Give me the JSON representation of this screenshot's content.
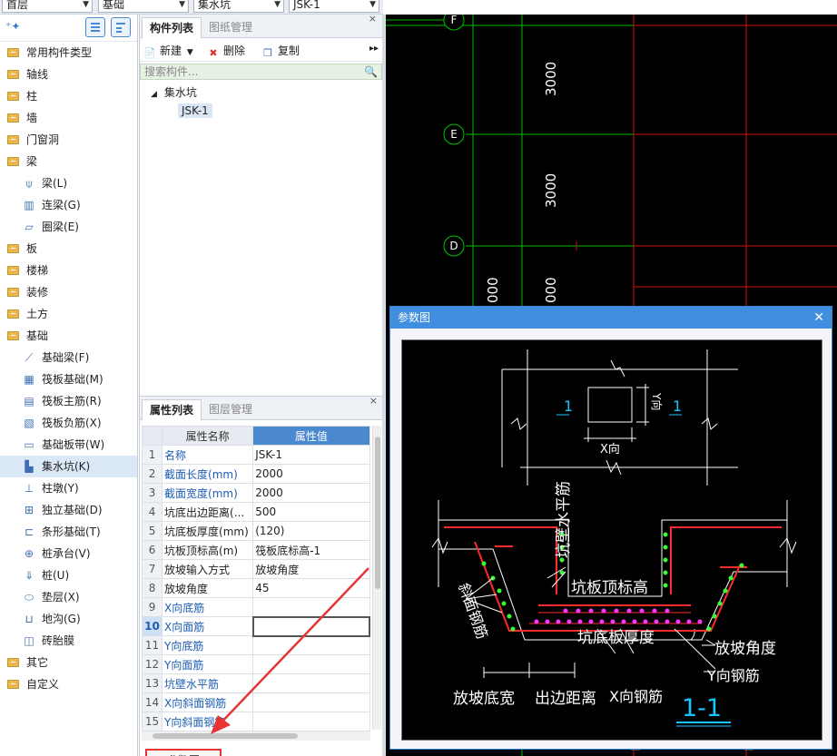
{
  "toolbar": {
    "floor": "首层",
    "category": "基础",
    "component_type": "集水坑",
    "component": "JSK-1"
  },
  "tree": {
    "items": [
      {
        "label": "常用构件类型",
        "level": 0,
        "icon": "folder-icon"
      },
      {
        "label": "轴线",
        "level": 0,
        "icon": "folder-icon"
      },
      {
        "label": "柱",
        "level": 0,
        "icon": "folder-icon"
      },
      {
        "label": "墙",
        "level": 0,
        "icon": "folder-icon"
      },
      {
        "label": "门窗洞",
        "level": 0,
        "icon": "folder-icon"
      },
      {
        "label": "梁",
        "level": 0,
        "icon": "folder-icon"
      },
      {
        "label": "梁(L)",
        "level": 1,
        "icon": "beam-icon"
      },
      {
        "label": "连梁(G)",
        "level": 1,
        "icon": "link-beam-icon"
      },
      {
        "label": "圈梁(E)",
        "level": 1,
        "icon": "ring-beam-icon"
      },
      {
        "label": "板",
        "level": 0,
        "icon": "folder-icon"
      },
      {
        "label": "楼梯",
        "level": 0,
        "icon": "folder-icon"
      },
      {
        "label": "装修",
        "level": 0,
        "icon": "folder-icon"
      },
      {
        "label": "土方",
        "level": 0,
        "icon": "folder-icon"
      },
      {
        "label": "基础",
        "level": 0,
        "icon": "folder-icon"
      },
      {
        "label": "基础梁(F)",
        "level": 1,
        "icon": "foundation-beam-icon"
      },
      {
        "label": "筏板基础(M)",
        "level": 1,
        "icon": "raft-icon"
      },
      {
        "label": "筏板主筋(R)",
        "level": 1,
        "icon": "raft-main-rebar-icon"
      },
      {
        "label": "筏板负筋(X)",
        "level": 1,
        "icon": "raft-neg-rebar-icon"
      },
      {
        "label": "基础板带(W)",
        "level": 1,
        "icon": "slab-strip-icon"
      },
      {
        "label": "集水坑(K)",
        "level": 1,
        "icon": "sump-icon",
        "selected": true
      },
      {
        "label": "柱墩(Y)",
        "level": 1,
        "icon": "column-pier-icon"
      },
      {
        "label": "独立基础(D)",
        "level": 1,
        "icon": "isolated-footing-icon"
      },
      {
        "label": "条形基础(T)",
        "level": 1,
        "icon": "strip-footing-icon"
      },
      {
        "label": "桩承台(V)",
        "level": 1,
        "icon": "pile-cap-icon"
      },
      {
        "label": "桩(U)",
        "level": 1,
        "icon": "pile-icon"
      },
      {
        "label": "垫层(X)",
        "level": 1,
        "icon": "cushion-icon"
      },
      {
        "label": "地沟(G)",
        "level": 1,
        "icon": "trench-icon"
      },
      {
        "label": "砖胎膜",
        "level": 1,
        "icon": "brick-mold-icon"
      },
      {
        "label": "其它",
        "level": 0,
        "icon": "folder-icon"
      },
      {
        "label": "自定义",
        "level": 0,
        "icon": "folder-icon"
      }
    ]
  },
  "component_panel": {
    "tab_active": "构件列表",
    "tab_inactive": "图纸管理",
    "new_label": "新建",
    "delete_label": "删除",
    "copy_label": "复制",
    "search_placeholder": "搜索构件...",
    "tree_root": "集水坑",
    "tree_child": "JSK-1"
  },
  "property_panel": {
    "tab_active": "属性列表",
    "tab_inactive": "图层管理",
    "col_name": "属性名称",
    "col_value": "属性值",
    "rows": [
      {
        "n": "1",
        "name": "名称",
        "value": "JSK-1",
        "blue": true
      },
      {
        "n": "2",
        "name": "截面长度(mm)",
        "value": "2000",
        "blue": true
      },
      {
        "n": "3",
        "name": "截面宽度(mm)",
        "value": "2000",
        "blue": true
      },
      {
        "n": "4",
        "name": "坑底出边距离(...",
        "value": "500",
        "blue": false
      },
      {
        "n": "5",
        "name": "坑底板厚度(mm)",
        "value": "(120)",
        "blue": false
      },
      {
        "n": "6",
        "name": "坑板顶标高(m)",
        "value": "筏板底标高-1",
        "blue": false
      },
      {
        "n": "7",
        "name": "放坡输入方式",
        "value": "放坡角度",
        "blue": false
      },
      {
        "n": "8",
        "name": "放坡角度",
        "value": "45",
        "blue": false
      },
      {
        "n": "9",
        "name": "X向底筋",
        "value": "",
        "blue": true
      },
      {
        "n": "10",
        "name": "X向面筋",
        "value": "",
        "blue": true,
        "selected": true
      },
      {
        "n": "11",
        "name": "Y向底筋",
        "value": "",
        "blue": true
      },
      {
        "n": "12",
        "name": "Y向面筋",
        "value": "",
        "blue": true
      },
      {
        "n": "13",
        "name": "坑壁水平筋",
        "value": "",
        "blue": true
      },
      {
        "n": "14",
        "name": "X向斜面钢筋",
        "value": "",
        "blue": true
      },
      {
        "n": "15",
        "name": "Y向斜面钢筋",
        "value": "",
        "blue": true
      }
    ],
    "param_button": "参数图"
  },
  "cad": {
    "axis_labels": [
      "F",
      "E",
      "D"
    ],
    "dims": [
      "3000",
      "3000",
      "000",
      "000"
    ]
  },
  "dialog": {
    "title": "参数图",
    "labels": {
      "sec_left": "1",
      "sec_right": "1",
      "y_dir": "Y向",
      "x_dir": "X向",
      "wall_horiz_rebar": "坑壁水平筋",
      "top_elev": "坑板顶标高",
      "slope_rebar": "斜面钢筋",
      "bottom_thick": "坑底板厚度",
      "slope_angle": "放坡角度",
      "y_rebar": "Y向钢筋",
      "slope_width": "放坡底宽",
      "edge_dist": "出边距离",
      "x_rebar": "X向钢筋",
      "section": "1-1"
    }
  },
  "colors": {
    "accent": "#4a88d0",
    "highlight_red": "#e53535",
    "cad_green": "#00c000",
    "cad_red": "#d01010",
    "rebar_green": "#33ff33",
    "rebar_magenta": "#ff33ff",
    "section_cyan": "#18c6ff"
  }
}
